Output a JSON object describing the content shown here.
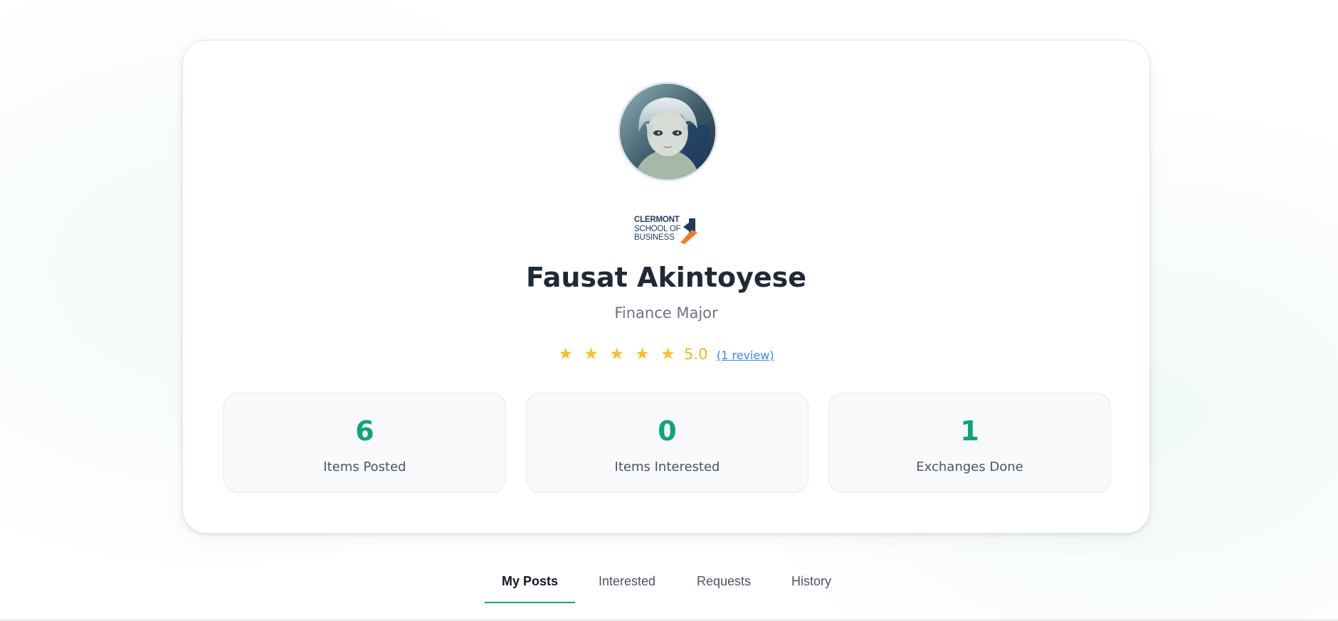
{
  "profile": {
    "name": "Fausat Akintoyese",
    "major": "Finance Major",
    "avatar_icon": "anime-avatar-image",
    "school_logo": {
      "line1": "CLERMONT",
      "line2": "SCHOOL OF",
      "line3": "BUSINESS",
      "accent_orange": "#f07c22",
      "accent_navy": "#1f3a5f"
    }
  },
  "rating": {
    "stars": "★ ★ ★ ★ ★",
    "stars_count": 5,
    "score": "5.0",
    "review_link": "(1 review)"
  },
  "stats": [
    {
      "value": "6",
      "label": "Items Posted"
    },
    {
      "value": "0",
      "label": "Items Interested"
    },
    {
      "value": "1",
      "label": "Exchanges Done"
    }
  ],
  "tabs": [
    {
      "label": "My Posts",
      "active": true
    },
    {
      "label": "Interested",
      "active": false
    },
    {
      "label": "Requests",
      "active": false
    },
    {
      "label": "History",
      "active": false
    }
  ],
  "colors": {
    "accent": "#10a37f",
    "star": "#fbbf24",
    "link": "#3b82f6",
    "text_dark": "#1f2937",
    "text_muted": "#6b7280"
  }
}
